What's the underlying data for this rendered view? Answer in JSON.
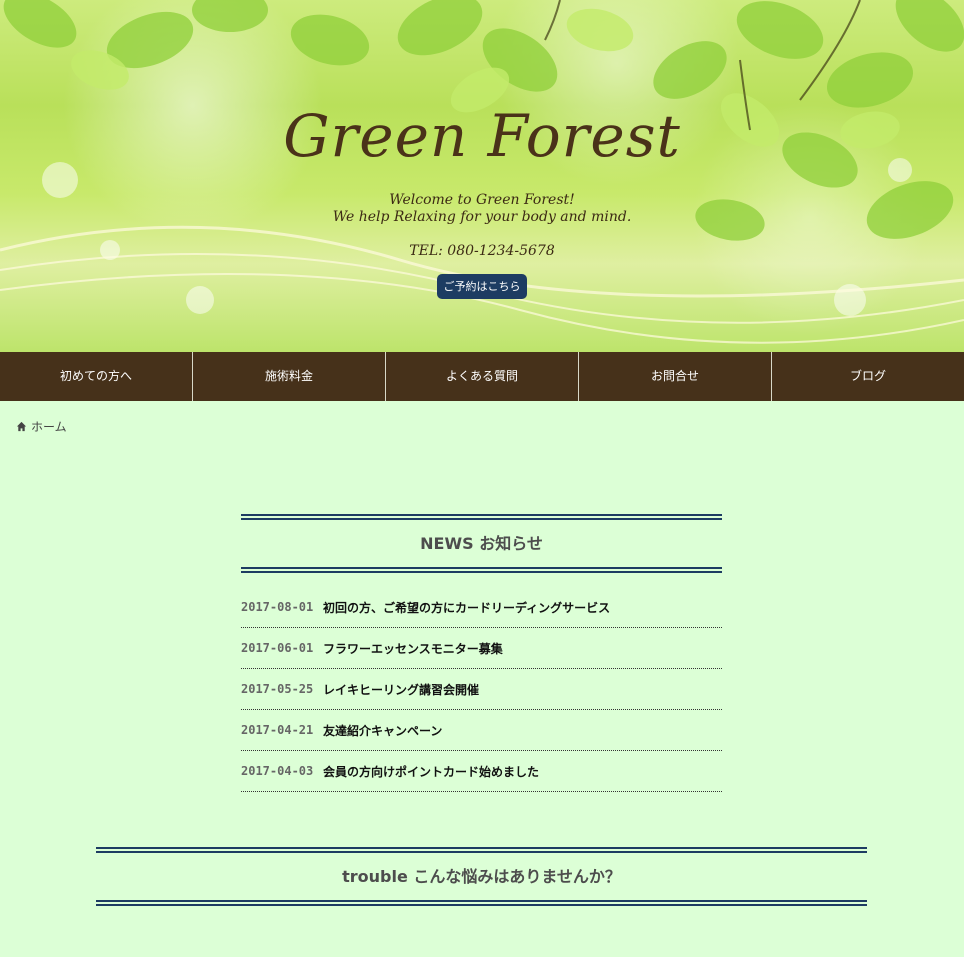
{
  "hero": {
    "title": "Green Forest",
    "tagline_line1": "Welcome to Green Forest!",
    "tagline_line2": "We help Relaxing for your body and mind.",
    "tel": "TEL: 080-1234-5678",
    "reserve_button": "ご予約はこちら"
  },
  "nav": {
    "items": [
      {
        "label": "初めての方へ"
      },
      {
        "label": "施術料金"
      },
      {
        "label": "よくある質問"
      },
      {
        "label": "お問合せ"
      },
      {
        "label": "ブログ"
      }
    ]
  },
  "breadcrumb": {
    "icon": "home-icon",
    "label": "ホーム"
  },
  "news": {
    "title": "NEWS お知らせ",
    "items": [
      {
        "date": "2017-08-01",
        "text": "初回の方、ご希望の方にカードリーディングサービス"
      },
      {
        "date": "2017-06-01",
        "text": "フラワーエッセンスモニター募集"
      },
      {
        "date": "2017-05-25",
        "text": "レイキヒーリング講習会開催"
      },
      {
        "date": "2017-04-21",
        "text": "友達紹介キャンペーン"
      },
      {
        "date": "2017-04-03",
        "text": "会員の方向けポイントカード始めました"
      }
    ]
  },
  "trouble": {
    "title": "trouble こんな悩みはありませんか？"
  },
  "colors": {
    "background": "#dcffd6",
    "nav": "#46311a",
    "accent": "#1d3c62",
    "title_brown": "#4a3219"
  }
}
